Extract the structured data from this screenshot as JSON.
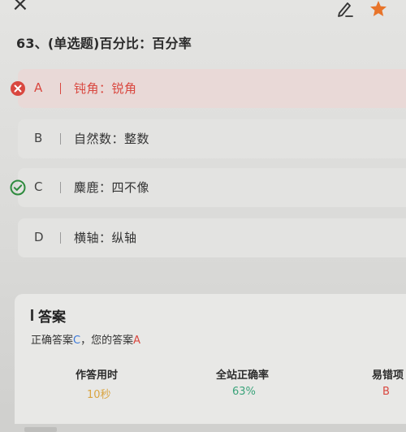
{
  "question": {
    "text": "63、(单选题)百分比：百分率"
  },
  "options": [
    {
      "letter": "A",
      "text": "钝角：锐角",
      "status": "wrong"
    },
    {
      "letter": "B",
      "text": "自然数：整数",
      "status": "none"
    },
    {
      "letter": "C",
      "text": "麋鹿：四不像",
      "status": "correct"
    },
    {
      "letter": "D",
      "text": "横轴：纵轴",
      "status": "none"
    }
  ],
  "answer": {
    "title": "答案",
    "correct_prefix": "正确答案",
    "correct_letter": "C",
    "your_prefix": "，您的答案",
    "your_letter": "A"
  },
  "stats": {
    "time_label": "作答用时",
    "time_value": "10秒",
    "rate_label": "全站正确率",
    "rate_value": "63%",
    "error_label": "易错项",
    "error_value": "B"
  },
  "colors": {
    "wrong": "#d9473f",
    "correct": "#2e8b3e",
    "time": "#d9a441",
    "rate": "#3aa37a",
    "error": "#d9473f",
    "star": "#e8742a"
  },
  "icons": {
    "close": "close-icon",
    "edit": "pen-icon",
    "favorite": "star-icon"
  }
}
